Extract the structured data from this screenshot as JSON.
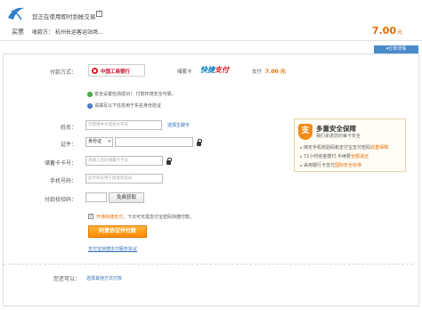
{
  "header": {
    "welcome_text": "您正在使用即时到帐交易",
    "flag_icon": "?",
    "buy_label": "买票",
    "seller_label": "收款方：",
    "seller_name": "杭州长运客运站场...",
    "amount": "7.00",
    "amount_unit": "元",
    "order_detail_label": "▾订单详情"
  },
  "payment": {
    "method_label": "付款方式：",
    "bank_name": "中国工商银行",
    "card_type": "储蓄卡",
    "quick_logo_a": "快捷",
    "quick_logo_b": "支付",
    "pay_label": "支付",
    "pay_amount": "7.00 元"
  },
  "security": {
    "line1": "安全设置检测成功！ 付款环境安全可靠。",
    "line2": "请填写以下信息用于实名身份验证"
  },
  "form": {
    "name_label": "姓名：",
    "name_placeholder": "可使用中文或英文字符",
    "name_hint": "选择生僻字",
    "id_label": "证件：",
    "id_type": "身份证",
    "card_label": "储蓄卡卡号：",
    "card_placeholder": "请输入您的储蓄卡卡号",
    "phone_label": "手机号码：",
    "phone_placeholder": "此手机号用于接收校验码",
    "code_label": "付款校验码：",
    "free_get_label": "免费获取",
    "agree_text_a": "开通快捷支付",
    "agree_text_b": "，下次可无需支付宝密码快捷付款。",
    "pay_button_label": "同意协议并付款",
    "protocol_link": "支付宝快捷支付服务协议"
  },
  "other": {
    "label": "您还可以：",
    "link": "选择其他方式付款"
  },
  "guard": {
    "icon_text": "支",
    "title": "多重安全保障",
    "subtitle": "我们承诺您的每卡安全",
    "item1_a": "绑定手机校验码和支付宝支付密码",
    "item1_b": "双重保障",
    "item2_a": "72小时资金赔付,手续费",
    "item2_b": "全额退还",
    "item3_a": "采用银行卡支付",
    "item3_b": "国际安全标准"
  }
}
